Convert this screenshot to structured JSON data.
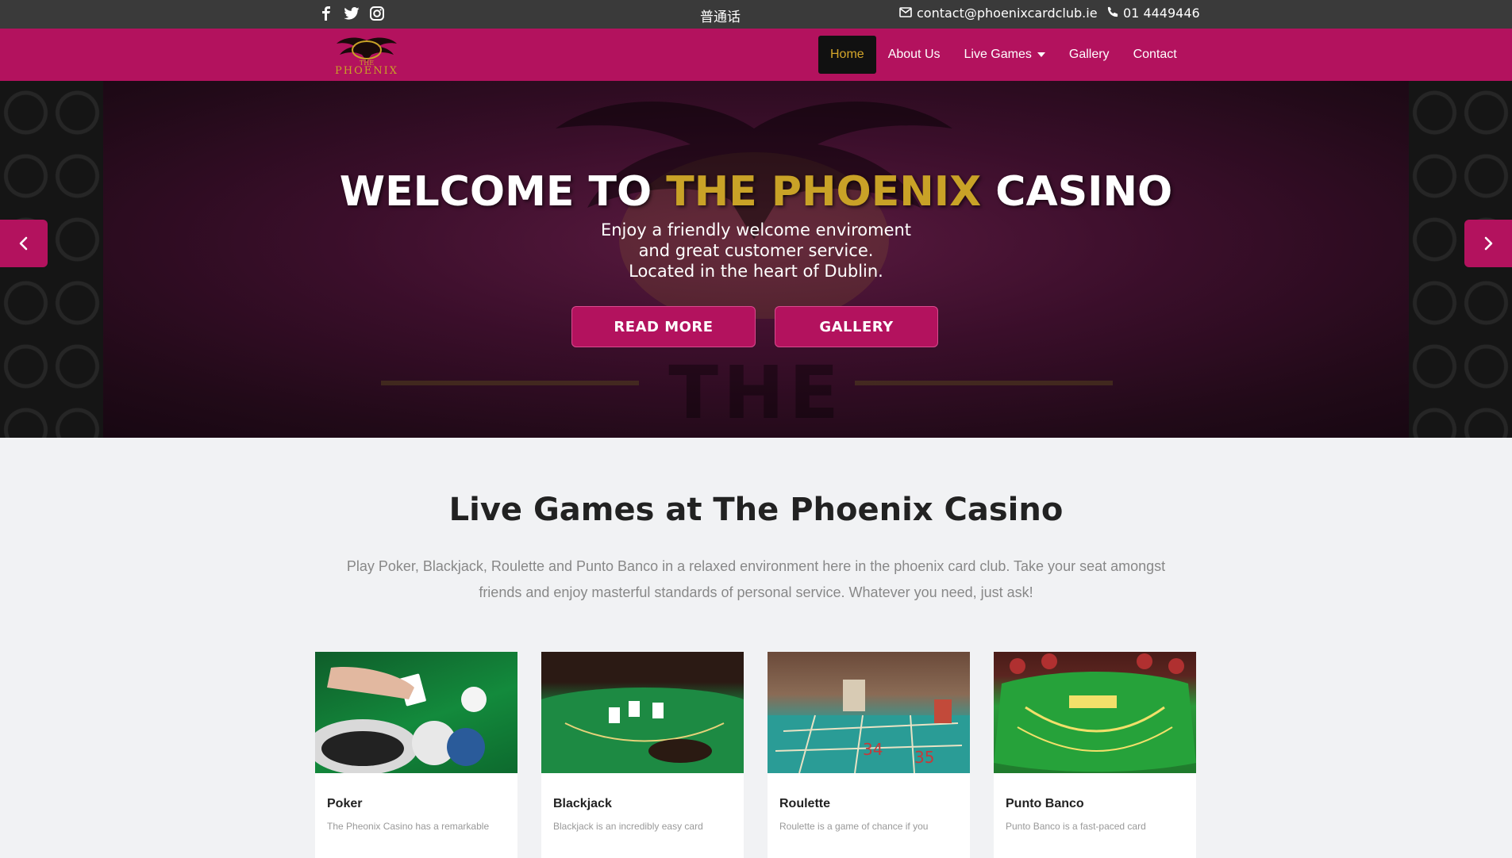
{
  "topbar": {
    "social": [
      "facebook-icon",
      "twitter-icon",
      "instagram-icon"
    ],
    "language": "普通话",
    "email": "contact@phoenixcardclub.ie",
    "phone": "01 4449446"
  },
  "nav": {
    "logo_alt": "THE PHOENIX",
    "items": [
      {
        "label": "Home",
        "active": true
      },
      {
        "label": "About Us"
      },
      {
        "label": "Live Games",
        "dropdown": true
      },
      {
        "label": "Gallery"
      },
      {
        "label": "Contact"
      }
    ]
  },
  "hero": {
    "title_pre": "WELCOME TO ",
    "title_highlight": "THE PHOENIX",
    "title_post": " CASINO",
    "subtitle_lines": [
      "Enjoy a friendly welcome enviroment",
      "and great customer service.",
      "Located in the heart of Dublin."
    ],
    "background_text": "THE",
    "buttons": {
      "read_more": "READ MORE",
      "gallery": "GALLERY"
    }
  },
  "section": {
    "title": "Live Games at The Phoenix Casino",
    "description": "Play Poker, Blackjack, Roulette and Punto Banco in a relaxed environment here in the phoenix card club. Take your seat amongst friends and enjoy masterful standards of personal service. Whatever you need, just ask!"
  },
  "cards": [
    {
      "title": "Poker",
      "text": "The Pheonix Casino has a remarkable"
    },
    {
      "title": "Blackjack",
      "text": "Blackjack is an incredibly easy card"
    },
    {
      "title": "Roulette",
      "text": "Roulette is a game of chance if you"
    },
    {
      "title": "Punto Banco",
      "text": "Punto Banco is a fast-paced card"
    }
  ],
  "colors": {
    "brand": "#b3125e",
    "gold": "#c9a227",
    "topbar": "#3a3a3a"
  }
}
